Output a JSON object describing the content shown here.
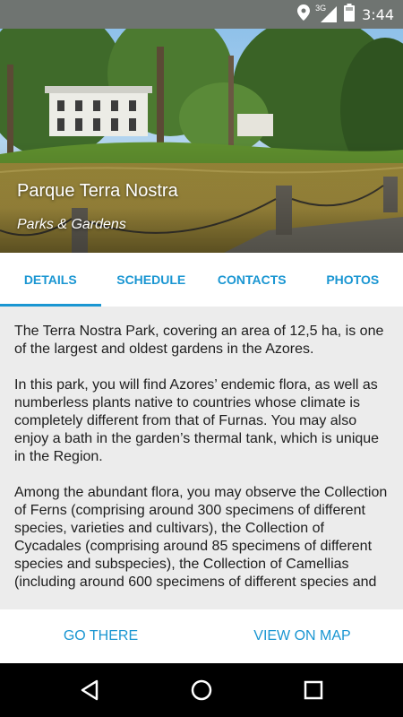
{
  "status_bar": {
    "time": "3:44",
    "network": "3G",
    "icons": [
      "location-icon",
      "signal-icon",
      "battery-icon"
    ]
  },
  "hero": {
    "title": "Parque Terra Nostra",
    "subtitle": "Parks & Gardens"
  },
  "tabs": [
    {
      "label": "DETAILS",
      "active": true
    },
    {
      "label": "SCHEDULE",
      "active": false
    },
    {
      "label": "CONTACTS",
      "active": false
    },
    {
      "label": "PHOTOS",
      "active": false
    }
  ],
  "content": {
    "paragraphs": [
      "The Terra Nostra Park, covering an area of 12,5 ha, is one of the largest and oldest gardens in the Azores.",
      "In this park, you will find Azores’ endemic flora, as well as numberless plants native to countries whose climate is completely different from that of Furnas. You may also enjoy a bath in the garden’s thermal tank, which is unique in the Region.",
      "Among the abundant flora, you may observe the Collection of Ferns (comprising around 300 specimens of different species, varieties and cultivars), the Collection of Cycadales (comprising around 85 specimens of different species and subspecies), the Collection of Camellias (including around 600 specimens of different species and"
    ]
  },
  "actions": {
    "go_there": "GO THERE",
    "view_on_map": "VIEW ON MAP"
  },
  "nav": {
    "back": "back-icon",
    "home": "home-icon",
    "recents": "recents-icon"
  },
  "colors": {
    "accent": "#1a96d2",
    "status_bar": "#6f7471",
    "background": "#ececec"
  }
}
